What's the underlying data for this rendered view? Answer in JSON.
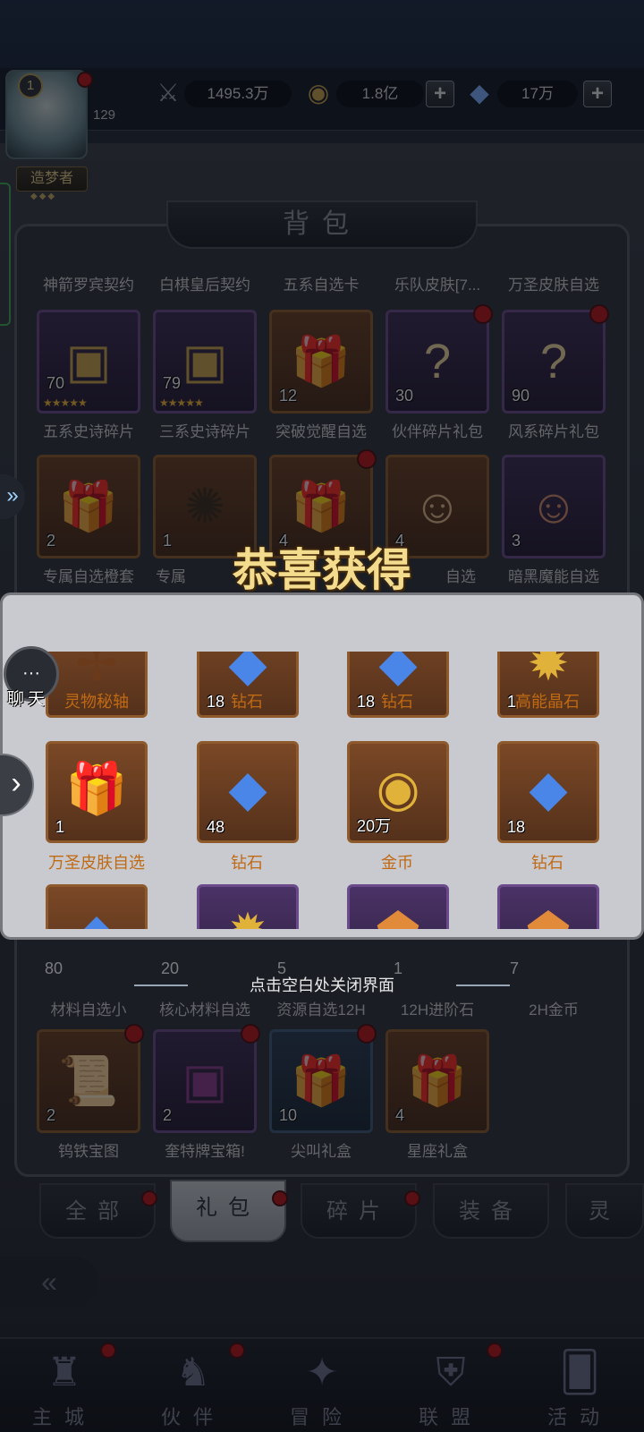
{
  "top": {
    "level": "1",
    "exp": "129",
    "title": "造梦者",
    "power": "1495.3万",
    "gold": "1.8亿",
    "diamond": "17万",
    "plus": "+"
  },
  "bag": {
    "header": "背包",
    "row0_labels": [
      "神箭罗宾契约",
      "白棋皇后契约",
      "五系自选卡",
      "乐队皮肤[7...",
      "万圣皮肤自选"
    ],
    "row1": [
      {
        "count": "70",
        "label": "五系史诗碎片"
      },
      {
        "count": "79",
        "label": "三系史诗碎片"
      },
      {
        "count": "12",
        "label": "突破觉醒自选"
      },
      {
        "count": "30",
        "label": "伙伴碎片礼包"
      },
      {
        "count": "90",
        "label": "风系碎片礼包"
      }
    ],
    "row2": [
      {
        "count": "2",
        "label": "专属自选橙套"
      },
      {
        "count": "1",
        "label": "专属"
      },
      {
        "count": "4",
        "label": ""
      },
      {
        "count": "4",
        "label": "自选"
      },
      {
        "count": "3",
        "label": "暗黑魔能自选"
      }
    ],
    "row3": [
      {
        "count": "80",
        "label": "材料自选小"
      },
      {
        "count": "20",
        "label": "核心材料自选"
      },
      {
        "count": "5",
        "label": "资源自选12H"
      },
      {
        "count": "1",
        "label": "12H进阶石"
      },
      {
        "count": "7",
        "label": "2H金币"
      }
    ],
    "row4": [
      {
        "count": "2",
        "label": "钨铁宝图"
      },
      {
        "count": "2",
        "label": "奎特牌宝箱!"
      },
      {
        "count": "10",
        "label": "尖叫礼盒"
      },
      {
        "count": "4",
        "label": "星座礼盒"
      }
    ]
  },
  "popup": {
    "title": "恭喜获得",
    "row0": [
      {
        "count": "",
        "label": "灵物秘轴"
      },
      {
        "count": "18",
        "label": "钻石"
      },
      {
        "count": "18",
        "label": "钻石"
      },
      {
        "count": "1",
        "label": "高能晶石"
      }
    ],
    "row1": [
      {
        "count": "1",
        "label": "万圣皮肤自选"
      },
      {
        "count": "48",
        "label": "钻石"
      },
      {
        "count": "20万",
        "label": "金币"
      },
      {
        "count": "18",
        "label": "钻石"
      }
    ],
    "close_hint": "点击空白处关闭界面"
  },
  "chat": {
    "label": "聊天",
    "icon": "···"
  },
  "tabs": [
    "全部",
    "礼包",
    "碎片",
    "装备",
    "灵"
  ],
  "nav": [
    "主城",
    "伙伴",
    "冒险",
    "联盟",
    "活动"
  ],
  "colors": {
    "accent_gold": "#f4dc8e",
    "popup_bg": "#c9cad0",
    "label_orange": "#c06a14",
    "badge_red": "#b8141a"
  }
}
